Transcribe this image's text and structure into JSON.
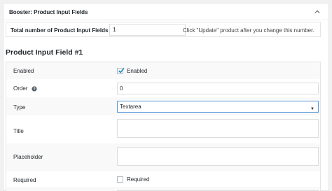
{
  "panel": {
    "title": "Booster: Product Input Fields"
  },
  "total": {
    "label": "Total number of Product Input Fields",
    "value": "1",
    "hint": "Click \"Update\" product after you change this number."
  },
  "section": {
    "title": "Product Input Field #1"
  },
  "fields": {
    "enabled": {
      "label": "Enabled",
      "checkbox_label": "Enabled",
      "checked": true
    },
    "order": {
      "label": "Order",
      "value": "0"
    },
    "type": {
      "label": "Type",
      "selected": "Textarea"
    },
    "title": {
      "label": "Title",
      "value": ""
    },
    "placeholder": {
      "label": "Placeholder",
      "value": ""
    },
    "required": {
      "label": "Required",
      "checkbox_label": "Required",
      "checked": false
    }
  },
  "colors": {
    "accent": "#1e8cbe",
    "focus_border": "#5b9dd9"
  }
}
